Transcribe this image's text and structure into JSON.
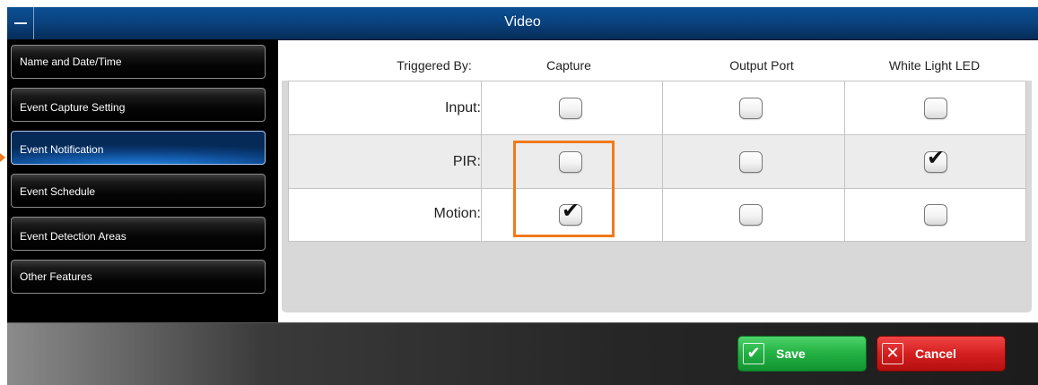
{
  "window": {
    "title": "Video"
  },
  "sidebar": {
    "items": [
      {
        "label": "Name and Date/Time"
      },
      {
        "label": "Event Capture Setting"
      },
      {
        "label": "Event Notification",
        "active": true
      },
      {
        "label": "Event Schedule"
      },
      {
        "label": "Event Detection Areas"
      },
      {
        "label": "Other Features"
      }
    ]
  },
  "table": {
    "headers": [
      "Triggered By:",
      "Capture",
      "Output Port",
      "White Light LED"
    ],
    "rows": [
      {
        "label": "Input:",
        "capture": false,
        "output_port": false,
        "white_light_led": false
      },
      {
        "label": "PIR:",
        "capture": false,
        "output_port": false,
        "white_light_led": true
      },
      {
        "label": "Motion:",
        "capture": true,
        "output_port": false,
        "white_light_led": false
      }
    ]
  },
  "footer": {
    "save_label": "Save",
    "cancel_label": "Cancel"
  },
  "icons": {
    "checkmark": "✔",
    "minimize": "minimize-icon"
  },
  "colors": {
    "title_bar": "#0a4380",
    "active_nav": "#1664b8",
    "highlight": "#f07a1c",
    "save": "#23b043",
    "cancel": "#d41f1f"
  }
}
